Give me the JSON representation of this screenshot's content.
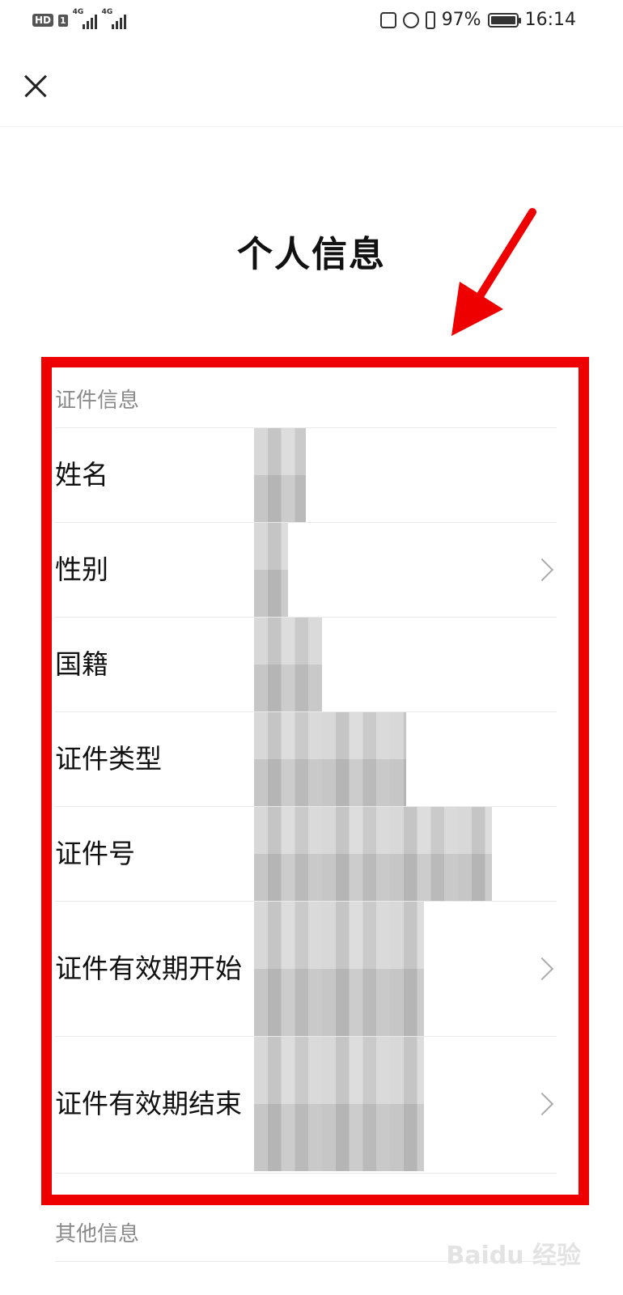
{
  "status_bar": {
    "hd_label": "HD",
    "sim_label": "1",
    "network_1": "4G",
    "network_2": "4G",
    "battery_percent": "97%",
    "time": "16:14",
    "icons": [
      "nfc-icon",
      "alarm-icon",
      "vibrate-icon",
      "battery-icon"
    ]
  },
  "nav": {
    "close_icon": "close-icon"
  },
  "page": {
    "title": "个人信息"
  },
  "annotation": {
    "frame_color": "#ee0000",
    "arrow_color": "#ee0000"
  },
  "sections": {
    "id_info": {
      "header": "证件信息",
      "rows": [
        {
          "label": "姓名",
          "has_chevron": false,
          "value_obscured": true
        },
        {
          "label": "性别",
          "has_chevron": true,
          "value_obscured": true
        },
        {
          "label": "国籍",
          "has_chevron": false,
          "value_obscured": true
        },
        {
          "label": "证件类型",
          "has_chevron": false,
          "value_obscured": true
        },
        {
          "label": "证件号",
          "has_chevron": false,
          "value_obscured": true
        },
        {
          "label": "证件有效期开始",
          "has_chevron": true,
          "value_obscured": true
        },
        {
          "label": "证件有效期结束",
          "has_chevron": true,
          "value_obscured": true
        }
      ]
    },
    "other_info": {
      "header": "其他信息"
    }
  },
  "watermark": "Baidu 经验"
}
